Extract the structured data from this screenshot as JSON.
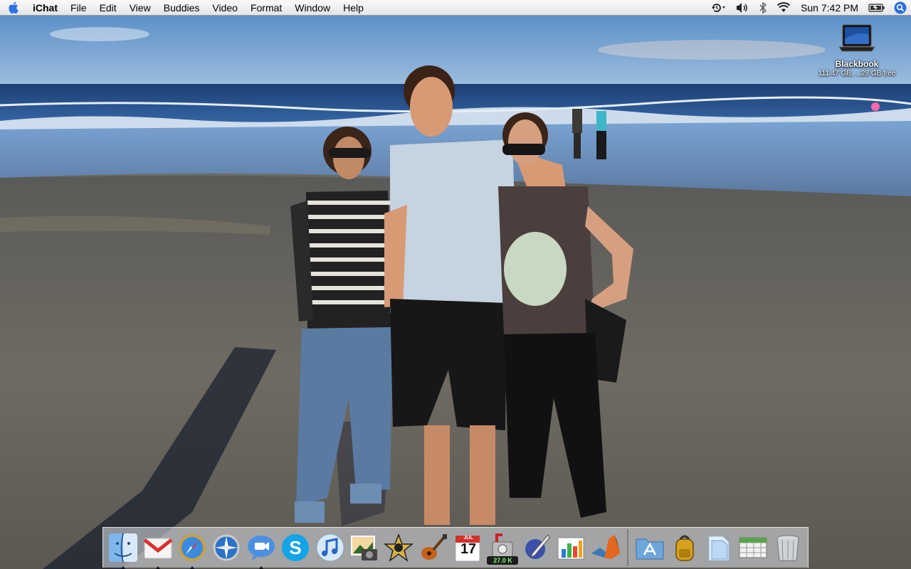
{
  "menubar": {
    "app_name": "iChat",
    "menus": [
      "File",
      "Edit",
      "View",
      "Buddies",
      "Video",
      "Format",
      "Window",
      "Help"
    ],
    "status_icons": [
      "time-machine-icon",
      "volume-icon",
      "bluetooth-icon",
      "wifi-icon"
    ],
    "clock": "Sun 7:42 PM",
    "battery_icon": "battery-icon",
    "spotlight_icon": "spotlight-search-icon"
  },
  "desktop": {
    "wallpaper": "beach photo of three people standing on the sand",
    "icons": [
      {
        "name": "Blackbook",
        "info": "111.47 GB, ...28 GB free",
        "icon": "laptop-icon"
      }
    ]
  },
  "dock": {
    "apps": [
      {
        "name": "Finder",
        "icon": "finder-icon",
        "running": true
      },
      {
        "name": "Gmail",
        "icon": "gmail-icon",
        "running": true
      },
      {
        "name": "Safari",
        "icon": "safari-icon",
        "running": true
      },
      {
        "name": "Network Utility",
        "icon": "compass-icon",
        "running": false
      },
      {
        "name": "iChat",
        "icon": "ichat-icon",
        "running": true
      },
      {
        "name": "Skype",
        "icon": "skype-icon",
        "running": false
      },
      {
        "name": "iTunes",
        "icon": "itunes-icon",
        "running": false
      },
      {
        "name": "iPhoto",
        "icon": "iphoto-icon",
        "running": false
      },
      {
        "name": "iMovie",
        "icon": "imovie-icon",
        "running": false
      },
      {
        "name": "GarageBand",
        "icon": "guitar-icon",
        "running": false
      },
      {
        "name": "iCal",
        "icon": "calendar-icon",
        "running": false,
        "month": "JUL",
        "day": "17"
      },
      {
        "name": "Transmission",
        "icon": "download-meter-icon",
        "running": false,
        "badge": "27.0 K"
      },
      {
        "name": "Script Editor",
        "icon": "quill-icon",
        "running": false
      },
      {
        "name": "Numbers",
        "icon": "bar-chart-icon",
        "running": false
      },
      {
        "name": "MATLAB",
        "icon": "matlab-icon",
        "running": false
      }
    ],
    "stacks": [
      {
        "name": "Applications",
        "icon": "applications-folder-icon"
      },
      {
        "name": "Backpack",
        "icon": "backpack-icon"
      },
      {
        "name": "Documents",
        "icon": "document-stack-icon"
      },
      {
        "name": "Spreadsheet",
        "icon": "spreadsheet-icon"
      },
      {
        "name": "Trash",
        "icon": "trash-icon"
      }
    ]
  }
}
